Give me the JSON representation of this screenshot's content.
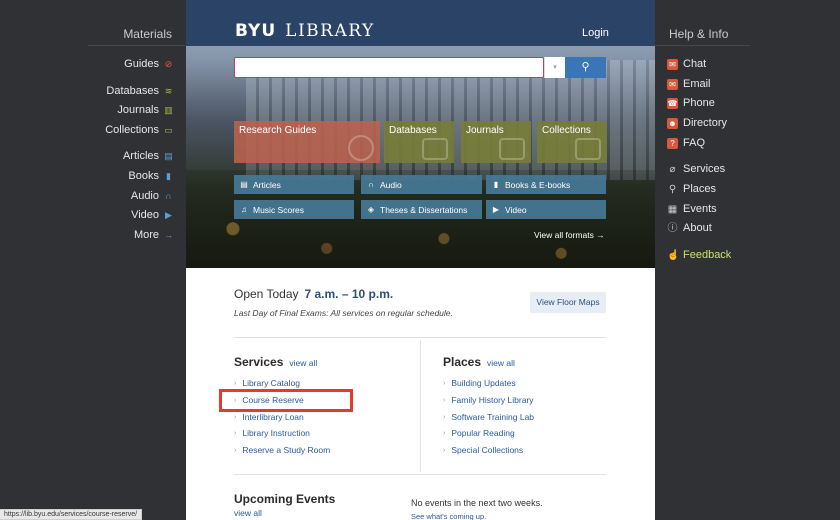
{
  "left": {
    "title": "Materials",
    "items": [
      {
        "label": "Guides",
        "icon": "compass-icon",
        "glyph": "⊘",
        "color": "#e05a3c"
      },
      {
        "label": "Databases",
        "icon": "stack-icon",
        "glyph": "≋",
        "color": "#a6b54a"
      },
      {
        "label": "Journals",
        "icon": "books-icon",
        "glyph": "▥",
        "color": "#a6b54a"
      },
      {
        "label": "Collections",
        "icon": "drawer-icon",
        "glyph": "▭",
        "color": "#a6b54a"
      },
      {
        "label": "Articles",
        "icon": "document-icon",
        "glyph": "▤",
        "color": "#5aa0d8"
      },
      {
        "label": "Books",
        "icon": "book-icon",
        "glyph": "▮",
        "color": "#5aa0d8"
      },
      {
        "label": "Audio",
        "icon": "headphones-icon",
        "glyph": "∩",
        "color": "#5aa0d8"
      },
      {
        "label": "Video",
        "icon": "video-icon",
        "glyph": "▶",
        "color": "#5aa0d8"
      },
      {
        "label": "More",
        "icon": "arrow-right-icon",
        "glyph": "→",
        "color": "#5aa0d8"
      }
    ]
  },
  "right": {
    "title": "Help & Info",
    "items": [
      {
        "label": "Chat",
        "icon": "chat-icon",
        "glyph": "✉",
        "color": "#d9573b"
      },
      {
        "label": "Email",
        "icon": "email-icon",
        "glyph": "✉",
        "color": "#d9573b"
      },
      {
        "label": "Phone",
        "icon": "phone-icon",
        "glyph": "☎",
        "color": "#d9573b"
      },
      {
        "label": "Directory",
        "icon": "person-icon",
        "glyph": "☻",
        "color": "#d9573b"
      },
      {
        "label": "FAQ",
        "icon": "question-icon",
        "glyph": "?",
        "color": "#d9573b"
      },
      {
        "label": "Services",
        "icon": "paperclip-icon",
        "glyph": "⌀",
        "color": "transparent"
      },
      {
        "label": "Places",
        "icon": "location-pin-icon",
        "glyph": "⚲",
        "color": "transparent"
      },
      {
        "label": "Events",
        "icon": "calendar-icon",
        "glyph": "▦",
        "color": "transparent"
      },
      {
        "label": "About",
        "icon": "info-icon",
        "glyph": "ⓘ",
        "color": "transparent"
      }
    ],
    "feedback": {
      "label": "Feedback",
      "icon": "thumbs-up-icon",
      "glyph": "☝",
      "color": "#b8d66a"
    }
  },
  "header": {
    "logo_bold": "BYU",
    "logo_rest": "LIBRARY",
    "login": "Login"
  },
  "search": {
    "placeholder": "",
    "dropdown": "▾",
    "button_icon": "search-icon"
  },
  "tiles": {
    "research_guides": "Research Guides",
    "databases": "Databases",
    "journals": "Journals",
    "collections": "Collections"
  },
  "formats": [
    {
      "label": "Articles",
      "icon": "document-icon",
      "glyph": "▤"
    },
    {
      "label": "Audio",
      "icon": "headphones-icon",
      "glyph": "∩"
    },
    {
      "label": "Books & E-books",
      "icon": "book-icon",
      "glyph": "▮"
    },
    {
      "label": "Music Scores",
      "icon": "music-note-icon",
      "glyph": "♫"
    },
    {
      "label": "Theses & Dissertations",
      "icon": "graduation-cap-icon",
      "glyph": "◈"
    },
    {
      "label": "Video",
      "icon": "video-icon",
      "glyph": "▶"
    }
  ],
  "view_all_formats": "View all formats →",
  "hours": {
    "label": "Open Today",
    "time": "7 a.m. – 10 p.m.",
    "note": "Last Day of Final Exams: All services on regular schedule."
  },
  "floor_maps": "View Floor Maps",
  "services": {
    "title": "Services",
    "view_all": "view all",
    "links": [
      "Library Catalog",
      "Course Reserve",
      "Interlibrary Loan",
      "Library Instruction",
      "Reserve a Study Room"
    ]
  },
  "places": {
    "title": "Places",
    "view_all": "view all",
    "links": [
      "Building Updates",
      "Family History Library",
      "Software Training Lab",
      "Popular Reading",
      "Special Collections"
    ]
  },
  "events": {
    "title": "Upcoming Events",
    "view_all": "view all",
    "none": "No events in the next two weeks.",
    "see": "See what's coming up."
  },
  "status_url": "https://lib.byu.edu/services/course-reserve/",
  "highlight_color": "#e33c2c"
}
